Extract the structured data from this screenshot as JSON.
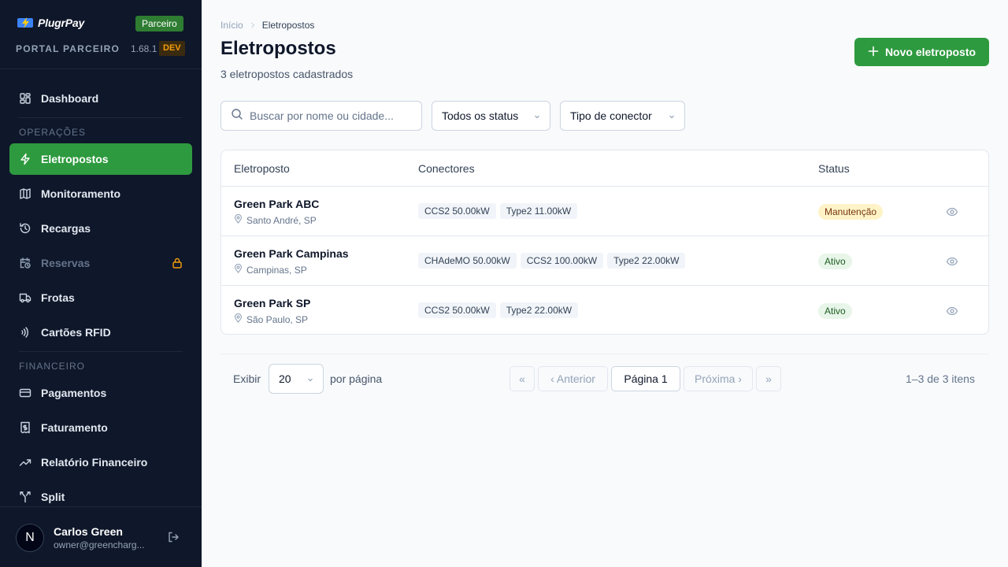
{
  "brand": {
    "name": "PlugrPay",
    "partner_badge": "Parceiro",
    "portal_label": "PORTAL PARCEIRO",
    "version": "1.68.1",
    "env": "DEV"
  },
  "sidebar": {
    "dashboard": "Dashboard",
    "section_ops": "OPERAÇÕES",
    "ops_items": [
      {
        "label": "Eletropostos",
        "icon": "zap-icon",
        "active": true
      },
      {
        "label": "Monitoramento",
        "icon": "map-icon"
      },
      {
        "label": "Recargas",
        "icon": "history-icon"
      },
      {
        "label": "Reservas",
        "icon": "calendar-clock-icon",
        "locked": true
      },
      {
        "label": "Frotas",
        "icon": "truck-icon"
      },
      {
        "label": "Cartões RFID",
        "icon": "nfc-icon"
      }
    ],
    "section_fin": "FINANCEIRO",
    "fin_items": [
      {
        "label": "Pagamentos",
        "icon": "credit-card-icon"
      },
      {
        "label": "Faturamento",
        "icon": "receipt-icon"
      },
      {
        "label": "Relatório Financeiro",
        "icon": "trending-up-icon"
      },
      {
        "label": "Split",
        "icon": "split-icon"
      }
    ]
  },
  "user": {
    "initial": "N",
    "name": "Carlos Green",
    "email": "owner@greencharg..."
  },
  "breadcrumb": {
    "home": "Início",
    "current": "Eletropostos"
  },
  "page": {
    "title": "Eletropostos",
    "subtitle": "3 eletropostos cadastrados",
    "new_button": "Novo eletroposto"
  },
  "filters": {
    "search_placeholder": "Buscar por nome ou cidade...",
    "status": "Todos os status",
    "connector": "Tipo de conector"
  },
  "table": {
    "headers": {
      "station": "Eletroposto",
      "connectors": "Conectores",
      "status": "Status"
    },
    "rows": [
      {
        "name": "Green Park ABC",
        "location": "Santo André, SP",
        "connectors": [
          "CCS2 50.00kW",
          "Type2 11.00kW"
        ],
        "status": "Manutenção",
        "status_kind": "maint"
      },
      {
        "name": "Green Park Campinas",
        "location": "Campinas, SP",
        "connectors": [
          "CHAdeMO 50.00kW",
          "CCS2 100.00kW",
          "Type2 22.00kW"
        ],
        "status": "Ativo",
        "status_kind": "active"
      },
      {
        "name": "Green Park SP",
        "location": "São Paulo, SP",
        "connectors": [
          "CCS2 50.00kW",
          "Type2 22.00kW"
        ],
        "status": "Ativo",
        "status_kind": "active"
      }
    ]
  },
  "pagination": {
    "show_label": "Exibir",
    "per_page": "20",
    "per_page_label": "por página",
    "first": "«",
    "prev": "‹ Anterior",
    "current": "Página 1",
    "next": "Próxima ›",
    "last": "»",
    "range": "1–3 de 3 itens"
  },
  "colors": {
    "accent": "#2e9a3f",
    "sidebar_bg": "#0f172a",
    "badge_green": "#2e7d32",
    "warn": "#f59e0b"
  }
}
